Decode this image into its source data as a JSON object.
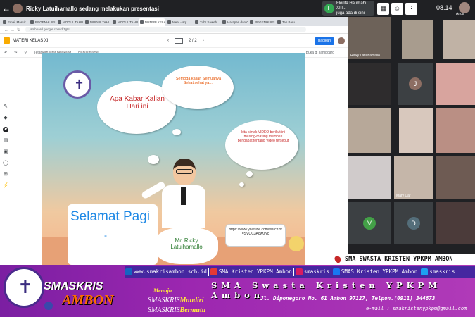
{
  "meet": {
    "presenting_text": "Ricky Latuihamallo sedang melakukan presentasi",
    "toast": {
      "initial": "F",
      "line1": "Florita Haumahu XI I...",
      "line2": "juga ada di sini"
    },
    "time": "08.14",
    "self_name": "Anda"
  },
  "browser": {
    "tabs": [
      "Email Masuk",
      "REGENHI IIELI",
      "MODUL TAHUN",
      "MODUL TAHUN",
      "MODUL TAHUN",
      "MATERI KELAS",
      "Meet - aqt",
      "Tuhr Saweh",
      "Harapan dan Ci",
      "REGENHI IIELI",
      "Tab Baru"
    ],
    "url": "jamboard.google.com/d/1gU...",
    "doc_title": "MATERI KELAS XI",
    "pager": "2 / 2",
    "share_label": "Bagikan",
    "toolbar": {
      "back": "Tetapkan latar belakang",
      "clear": "Hapus frame",
      "right": "Buka di Jamboard"
    },
    "left_tools": [
      "pen-icon",
      "eraser-icon",
      "select-icon",
      "sticky-note-icon",
      "image-icon",
      "circle-icon",
      "textbox-icon",
      "laser-icon"
    ]
  },
  "slide": {
    "greeting_cloud": "Apa Kabar Kalian Hari ini",
    "wish_cloud": "Semoga kalian Semuanya Sehat sehat ya....",
    "video_cloud": "kita simak VIDEO berikut ini masing-masing memberi pendapat tentang Video tersebut",
    "selamat": "Selamat Pagi",
    "selamat_dash": "-",
    "teacher_name": "Mr. Ricky Latuihamallo",
    "youtube_url": "https://www.youtube.com/watch?v=SVQC3A8w0Nc"
  },
  "participants": [
    {
      "name": "Ricky Latuihamallo",
      "color": "#6d6259"
    },
    {
      "name": "",
      "color": "#a89c8e"
    },
    {
      "name": "",
      "color": "#c0b2a5"
    },
    {
      "name": "",
      "color": "#2e2c2d"
    },
    {
      "letter": "J",
      "name": "",
      "color": "#3c4043",
      "letter_color": "#8d6e63"
    },
    {
      "name": "",
      "color": "#d8a49e"
    },
    {
      "name": "",
      "color": "#b7a899"
    },
    {
      "name": "",
      "color": "#d8c8bd"
    },
    {
      "name": "",
      "color": "#ba8f84"
    },
    {
      "name": "",
      "color": "#d0cbcb"
    },
    {
      "name": "Mary Car",
      "color": "#c5b6a9"
    },
    {
      "name": "",
      "color": "#6e5b53"
    },
    {
      "letter": "V",
      "name": "",
      "color": "#3c4043",
      "letter_color": "#43a047"
    },
    {
      "letter": "D",
      "name": "",
      "color": "#3c4043",
      "letter_color": "#546e7a"
    },
    {
      "name": "",
      "color": "#4b3b3a"
    }
  ],
  "banner": {
    "location_label": "SMA SWASTA KRISTEN YPKPM AMBON",
    "website": "www.smakrisambon.sch.id",
    "youtube": "SMA Kristen YPKPM Ambon",
    "instagram": "smaskris",
    "facebook": "SMAS Kristen YPKPM Ambon",
    "twitter": "smaskris",
    "brand_top": "SMASKRIS",
    "brand_bottom": "AMBON",
    "menuju": "Menuju",
    "motto1_a": "SMASKRIS",
    "motto1_b": "Mandiri",
    "motto2_a": "SMASKRIS",
    "motto2_b": "Bermutu",
    "school_name": "SMA Swasta Kristen YPKPM Ambon",
    "address": "Jl. Diponegoro  No. 61 Ambon 97127, Telpon.(0911) 344673",
    "email": "e-mail : smakristenypkpm@gmail.com"
  }
}
